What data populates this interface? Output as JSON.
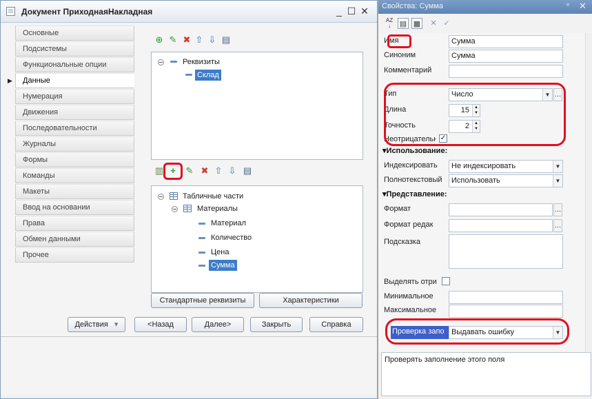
{
  "doc": {
    "title": "Документ ПриходнаяНакладная",
    "win_controls": {
      "minimize": "_",
      "maximize": "☐",
      "close": "✕"
    },
    "nav": [
      {
        "label": "Основные"
      },
      {
        "label": "Подсистемы"
      },
      {
        "label": "Функциональные опции"
      },
      {
        "label": "Данные"
      },
      {
        "label": "Нумерация"
      },
      {
        "label": "Движения"
      },
      {
        "label": "Последовательности"
      },
      {
        "label": "Журналы"
      },
      {
        "label": "Формы"
      },
      {
        "label": "Команды"
      },
      {
        "label": "Макеты"
      },
      {
        "label": "Ввод на основании"
      },
      {
        "label": "Права"
      },
      {
        "label": "Обмен данными"
      },
      {
        "label": "Прочее"
      }
    ],
    "active_nav_marker": "▶",
    "tree1": {
      "root": "Реквизиты",
      "child": "Склад"
    },
    "tree2": {
      "root": "Табличные части",
      "table": "Материалы",
      "fields": [
        "Материал",
        "Количество",
        "Цена",
        "Сумма"
      ]
    },
    "buttons": {
      "std_attrs": "Стандартные реквизиты",
      "characteristics": "Характеристики",
      "actions": "Действия",
      "actions_arrow": "▾",
      "back": "<Назад",
      "next": "Далее>",
      "close": "Закрыть",
      "help": "Справка"
    }
  },
  "props": {
    "title": "Свойства: Сумма",
    "pin": "ᵠ",
    "close": "✕",
    "toolbar_extra": {
      "clear": "✕",
      "ok": "✓"
    },
    "name": {
      "label": "Имя",
      "value": "Сумма"
    },
    "synonym": {
      "label": "Синоним",
      "value": "Сумма"
    },
    "comment": {
      "label": "Комментарий",
      "value": ""
    },
    "type": {
      "label": "Тип",
      "value": "Число"
    },
    "length": {
      "label": "Длина",
      "value": "15"
    },
    "precision": {
      "label": "Точность",
      "value": "2"
    },
    "nonneg": {
      "label": "Неотрицательн",
      "checked": "✓"
    },
    "usage_section": "Использование:",
    "indexing": {
      "label": "Индексировать",
      "value": "Не индексировать"
    },
    "fulltext": {
      "label": "Полнотекстовый",
      "value": "Использовать"
    },
    "view_section": "Представление:",
    "format": {
      "label": "Формат",
      "value": ""
    },
    "edit_format": {
      "label": "Формат редак",
      "value": ""
    },
    "tooltip": {
      "label": "Подсказка",
      "value": ""
    },
    "highlight_neg": {
      "label": "Выделять отри"
    },
    "minimum": {
      "label": "Минимальное",
      "value": ""
    },
    "maximum": {
      "label": "Максимальное",
      "value": ""
    },
    "fill_check": {
      "label": "Проверка запо",
      "value": "Выдавать ошибку"
    },
    "description": "Проверять заполнение этого поля"
  },
  "colors": {
    "highlight": "#e01020",
    "selection": "#3d7cc9",
    "title_blue": "#6b8fbf"
  }
}
